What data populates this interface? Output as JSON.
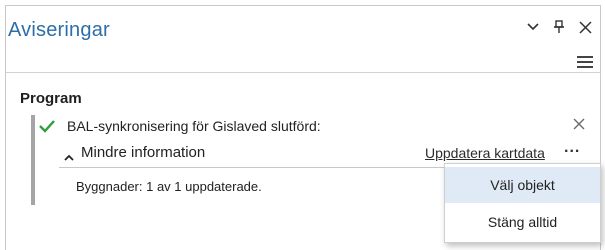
{
  "pane": {
    "title": "Aviseringar",
    "controls": {
      "dropdown_icon": "chevron-down-icon",
      "pin_icon": "pin-icon",
      "close_icon": "close-icon",
      "menu_icon": "hamburger-menu-icon"
    }
  },
  "section": {
    "title": "Program"
  },
  "notification": {
    "status_icon": "check-icon",
    "status_color": "#2e9e3f",
    "message": "BAL-synkronisering för Gislaved slutförd:",
    "dismiss_icon": "close-icon",
    "toggle_label": "Mindre information",
    "action_link": "Uppdatera kartdata",
    "more_label": "...",
    "detail": "Byggnader: 1 av 1 uppdaterade."
  },
  "context_menu": {
    "items": [
      {
        "label": "Välj objekt"
      },
      {
        "label": "Stäng alltid"
      }
    ],
    "hover_color": "#dfeaf6"
  },
  "colors": {
    "title": "#2e6ea8",
    "accent_bar": "#a5a5a5"
  }
}
